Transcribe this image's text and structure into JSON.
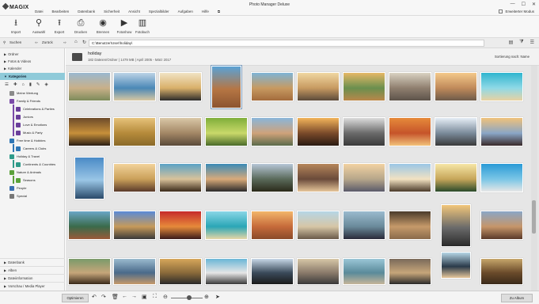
{
  "window": {
    "title": "Photo Manager Deluxe",
    "logo": "MAGIX",
    "advanced_mode": "Erweiterter Modus",
    "controls": [
      "—",
      "☐",
      "✕"
    ]
  },
  "menu": [
    "Datei",
    "Bearbeiten",
    "Datenbank",
    "Sicherheit",
    "Ansicht",
    "Spezialbilder",
    "Aufgaben",
    "Hilfe"
  ],
  "toolbar": [
    {
      "label": "Import",
      "icon": "import-icon",
      "glyph": "⭳"
    },
    {
      "label": "Auswahl",
      "icon": "search-icon",
      "glyph": "⚲"
    },
    {
      "label": "Export",
      "icon": "export-icon",
      "glyph": "⭱"
    },
    {
      "label": "Drucken",
      "icon": "print-icon",
      "glyph": "⎙"
    },
    {
      "label": "Brennen",
      "icon": "disc-icon",
      "glyph": "◉"
    },
    {
      "label": "Fotoshow",
      "icon": "play-icon",
      "glyph": "▶"
    },
    {
      "label": "Fotobuch",
      "icon": "book-icon",
      "glyph": "▥"
    }
  ],
  "pathbar": {
    "search": "Suchen",
    "back": "Zurück",
    "path": "C:\\Benutzer\\User\\holiday\\"
  },
  "sidebar": {
    "sections_top": [
      "Ordner",
      "Fotos & Videos",
      "Kalender",
      "Kategorien"
    ],
    "categories": [
      {
        "label": "Meine Wertung",
        "color": "#8a8a8a",
        "level": 0
      },
      {
        "label": "Family & Friends",
        "color": "#7a4aa8",
        "level": 0
      },
      {
        "label": "Celebrations & Parties",
        "color": "#6a3f9a",
        "level": 1
      },
      {
        "label": "Juniors",
        "color": "#6a3f9a",
        "level": 1
      },
      {
        "label": "Love & Emotions",
        "color": "#6a3f9a",
        "level": 1
      },
      {
        "label": "Music & Party",
        "color": "#6a3f9a",
        "level": 1
      },
      {
        "label": "Free time & Hobbies",
        "color": "#2f76b5",
        "level": 0
      },
      {
        "label": "Careers & Clubs",
        "color": "#2f76b5",
        "level": 1
      },
      {
        "label": "Holiday & Travel",
        "color": "#2f9a8a",
        "level": 0
      },
      {
        "label": "Continents & Countries",
        "color": "#2f9a8a",
        "level": 1
      },
      {
        "label": "Nature & Animals",
        "color": "#5aa13a",
        "level": 0
      },
      {
        "label": "Seasons",
        "color": "#5aa13a",
        "level": 1
      },
      {
        "label": "People",
        "color": "#3a6fb0",
        "level": 0
      },
      {
        "label": "Special",
        "color": "#777777",
        "level": 0
      }
    ],
    "sections_bottom": [
      "Datenbank",
      "Alben",
      "Dateiinformation",
      "Vorschau / Media Player"
    ]
  },
  "folder": {
    "name": "holiday",
    "info": "182 Dateien/Ordner | 1479 MB | April 2005 - März 2017",
    "sort": "Sortierung nach: Name"
  },
  "bottombar": {
    "optimize": "Optimieren",
    "album": "Zu Album"
  },
  "photos": [
    {
      "g": [
        "#9ab8cf",
        "#c9b089",
        "#7d8b5a"
      ]
    },
    {
      "g": [
        "#bcd3e6",
        "#4b88b6",
        "#d7c7a2"
      ]
    },
    {
      "g": [
        "#f1e3c4",
        "#d9b06a",
        "#2b2b2b"
      ]
    },
    {
      "g": [
        "#5aa2d6",
        "#b67644",
        "#8b5430"
      ]
    },
    {
      "g": [
        "#7eb4d6",
        "#c79a61",
        "#a36b3c"
      ]
    },
    {
      "g": [
        "#f0d7a1",
        "#c79a61",
        "#5b4a3a"
      ]
    },
    {
      "g": [
        "#e6b867",
        "#6a8f4e",
        "#b9874a"
      ]
    },
    {
      "g": [
        "#d9d2c2",
        "#8f7f6f",
        "#5d534a"
      ]
    },
    {
      "g": [
        "#f4c98a",
        "#c08a5a",
        "#6d5a4a"
      ]
    },
    {
      "g": [
        "#2fb5cf",
        "#8fd9e6",
        "#e8d2a2"
      ]
    },
    {
      "g": [
        "#6b4a2a",
        "#c7903a",
        "#2b1e14"
      ]
    },
    {
      "g": [
        "#e6c27a",
        "#b58a3a",
        "#8a6a2a"
      ]
    },
    {
      "g": [
        "#d9c7a7",
        "#a38765",
        "#5a4a3a"
      ]
    },
    {
      "g": [
        "#7fae3a",
        "#c9d96a",
        "#4a6a2a"
      ]
    },
    {
      "g": [
        "#8ab6da",
        "#cfa27a",
        "#5a6a4a"
      ]
    },
    {
      "g": [
        "#f2b45a",
        "#7a4a2a",
        "#2a1a12"
      ]
    },
    {
      "g": [
        "#dcdcdc",
        "#6a6a6a",
        "#3a3a3a"
      ]
    },
    {
      "g": [
        "#e68a3a",
        "#c6542a",
        "#f2c27a"
      ]
    },
    {
      "g": [
        "#e6eef6",
        "#7a8a9a",
        "#3a3a3a"
      ]
    },
    {
      "g": [
        "#f0c27a",
        "#8aa6c6",
        "#3a2a2a"
      ]
    },
    {
      "g": [
        "#4a8ac6",
        "#9ac6e6",
        "#2a4a6a"
      ]
    },
    {
      "g": [
        "#f2d29a",
        "#caa05a",
        "#5a3a2a"
      ]
    },
    {
      "g": [
        "#5aa2c6",
        "#d9c29a",
        "#3a2a1a"
      ]
    },
    {
      "g": [
        "#3a8ab6",
        "#d8aa7a",
        "#2a2a2a"
      ]
    },
    {
      "g": [
        "#b6c6d6",
        "#5a6a5a",
        "#2a2a1a"
      ]
    },
    {
      "g": [
        "#b6865a",
        "#6a4a3a",
        "#e6c69a"
      ]
    },
    {
      "g": [
        "#f2d2a2",
        "#b6a68a",
        "#5a5a6a"
      ]
    },
    {
      "g": [
        "#9ac6e6",
        "#f2e2c2",
        "#4a3a2a"
      ]
    },
    {
      "g": [
        "#f6e6a6",
        "#c6a65a",
        "#2a4a2a"
      ]
    },
    {
      "g": [
        "#2a9ad6",
        "#7ac6e6",
        "#e6e6e6"
      ]
    },
    {
      "g": [
        "#6aa6c6",
        "#3a6a4a",
        "#9a5a3a"
      ]
    },
    {
      "g": [
        "#5a8ad6",
        "#c69a5a",
        "#3a3a3a"
      ]
    },
    {
      "g": [
        "#c62a2a",
        "#e68a3a",
        "#3a1a1a"
      ]
    },
    {
      "g": [
        "#8ad6e6",
        "#2aa6b6",
        "#e6d6a6"
      ]
    },
    {
      "g": [
        "#f2b66a",
        "#c66a3a",
        "#8a4a2a"
      ]
    },
    {
      "g": [
        "#b6d6e6",
        "#d6c6a6",
        "#6a5a4a"
      ]
    },
    {
      "g": [
        "#9abace",
        "#6a8a9a",
        "#2a2a3a"
      ]
    },
    {
      "g": [
        "#4a3a2a",
        "#c69a6a",
        "#8a6a4a"
      ]
    },
    {
      "g": [
        "#f2c67a",
        "#6a6a6a",
        "#2a2a2a"
      ]
    },
    {
      "g": [
        "#8aa6c6",
        "#c6966a",
        "#5a3a2a"
      ]
    },
    {
      "g": [
        "#7a9a6a",
        "#c6a67a",
        "#3a2a1a"
      ]
    },
    {
      "g": [
        "#9abace",
        "#4a6a8a",
        "#c69a6a"
      ]
    },
    {
      "g": [
        "#d6a65a",
        "#8a6a3a",
        "#2a2a2a"
      ]
    },
    {
      "g": [
        "#6ab6d6",
        "#e6e6e6",
        "#3a3a3a"
      ]
    },
    {
      "g": [
        "#c6d6e6",
        "#3a4a5a",
        "#1a1a1a"
      ]
    },
    {
      "g": [
        "#d6c6a6",
        "#8a7a6a",
        "#3a3a3a"
      ]
    },
    {
      "g": [
        "#9ac6d6",
        "#5a8a9a",
        "#c6b69a"
      ]
    },
    {
      "g": [
        "#7a6a5a",
        "#c6a67a",
        "#2a2a2a"
      ]
    },
    {
      "g": [
        "#b6d6e6",
        "#2a3a4a",
        "#e6c69a"
      ]
    },
    {
      "g": [
        "#c6a66a",
        "#6a4a2a",
        "#3a2a1a"
      ]
    }
  ]
}
